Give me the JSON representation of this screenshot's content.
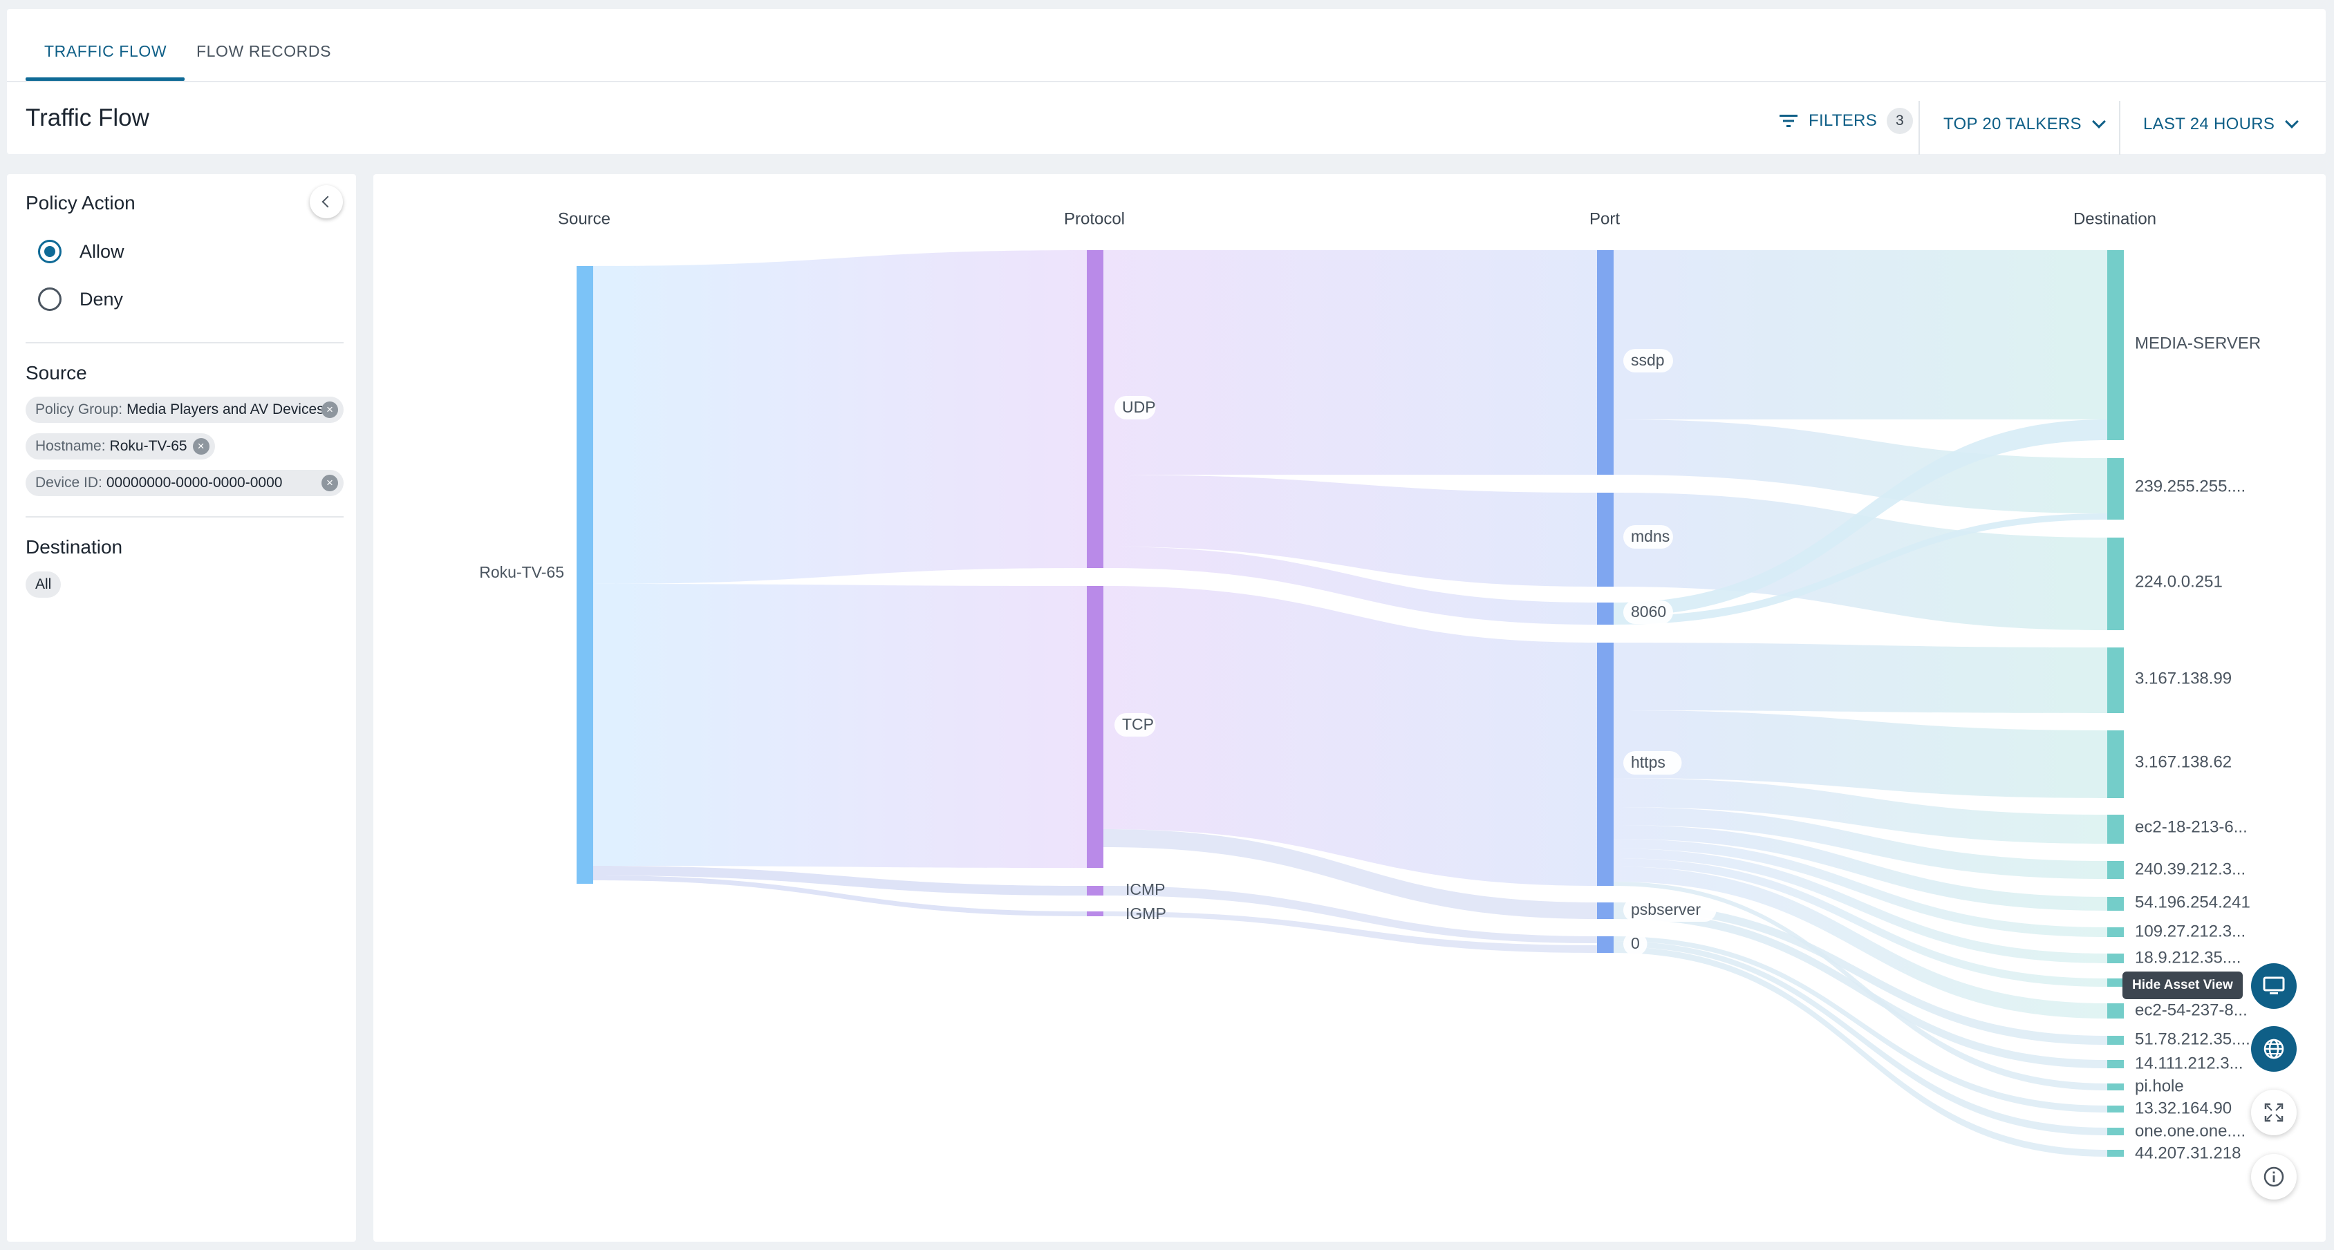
{
  "tabs": [
    {
      "label": "TRAFFIC FLOW",
      "active": true
    },
    {
      "label": "FLOW RECORDS",
      "active": false
    }
  ],
  "page_title": "Traffic Flow",
  "toolbar": {
    "filters_label": "FILTERS",
    "filters_count": "3",
    "talkers_label": "TOP 20 TALKERS",
    "time_label": "LAST 24 HOURS"
  },
  "filters": {
    "policy_action": {
      "title": "Policy Action",
      "options": [
        {
          "label": "Allow",
          "selected": true
        },
        {
          "label": "Deny",
          "selected": false
        }
      ]
    },
    "source": {
      "title": "Source",
      "chips": [
        {
          "key": "Policy Group:",
          "value": "Media Players and AV Devices"
        },
        {
          "key": "Hostname:",
          "value": "Roku-TV-65"
        },
        {
          "key": "Device ID:",
          "value": "00000000-0000-0000-0000"
        }
      ]
    },
    "destination": {
      "title": "Destination",
      "chips": [
        {
          "value": "All"
        }
      ]
    }
  },
  "sankey": {
    "columns": [
      "Source",
      "Protocol",
      "Port",
      "Destination"
    ],
    "colors": {
      "source": "#7cc3f7",
      "protocol": "#b98ae8",
      "port": "#7fa6f0",
      "destination": "#74cdc9"
    },
    "source": [
      {
        "label": "Roku-TV-65"
      }
    ],
    "protocols": [
      {
        "label": "UDP"
      },
      {
        "label": "TCP"
      },
      {
        "label": "ICMP"
      },
      {
        "label": "IGMP"
      }
    ],
    "ports": [
      {
        "label": "ssdp"
      },
      {
        "label": "mdns"
      },
      {
        "label": "8060"
      },
      {
        "label": "https"
      },
      {
        "label": "psbserver"
      },
      {
        "label": "0"
      }
    ],
    "destinations": [
      {
        "label": "MEDIA-SERVER"
      },
      {
        "label": "239.255.255...."
      },
      {
        "label": "224.0.0.251"
      },
      {
        "label": "3.167.138.99"
      },
      {
        "label": "3.167.138.62"
      },
      {
        "label": "ec2-18-213-6..."
      },
      {
        "label": "240.39.212.3..."
      },
      {
        "label": "54.196.254.241"
      },
      {
        "label": "109.27.212.3..."
      },
      {
        "label": "18.9.212.35...."
      },
      {
        "label": "ec2-3..."
      },
      {
        "label": "ec2-54-237-8..."
      },
      {
        "label": "51.78.212.35...."
      },
      {
        "label": "14.111.212.3..."
      },
      {
        "label": "pi.hole"
      },
      {
        "label": "13.32.164.90"
      },
      {
        "label": "one.one.one...."
      },
      {
        "label": "44.207.31.218"
      }
    ]
  },
  "floating": {
    "tooltip": "Hide Asset View",
    "buttons": [
      {
        "icon": "monitor-icon"
      },
      {
        "icon": "globe-icon"
      },
      {
        "icon": "expand-icon"
      },
      {
        "icon": "info-icon"
      }
    ]
  }
}
